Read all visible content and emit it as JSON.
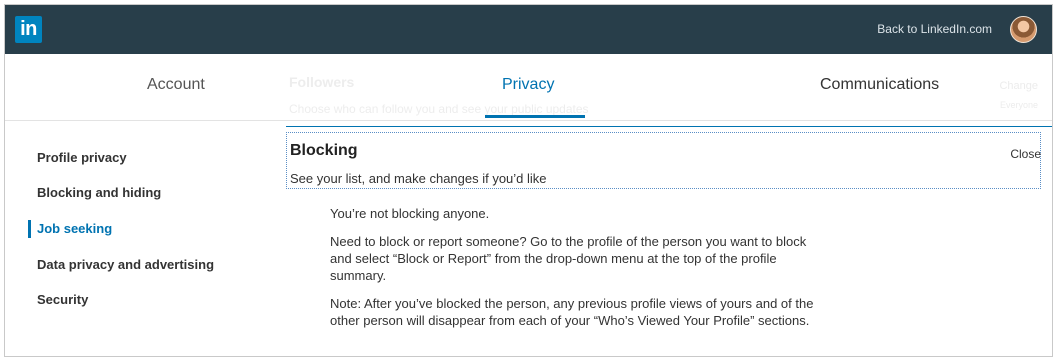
{
  "header": {
    "logo_text": "in",
    "back_link": "Back to LinkedIn.com"
  },
  "tabs": {
    "account": "Account",
    "privacy": "Privacy",
    "communications": "Communications"
  },
  "background_section": {
    "title": "Followers",
    "subtitle": "Choose who can follow you and see your public updates",
    "change": "Change",
    "status": "Everyone"
  },
  "sidebar": {
    "items": [
      {
        "label": "Profile privacy"
      },
      {
        "label": "Blocking and hiding"
      },
      {
        "label": "Job seeking"
      },
      {
        "label": "Data privacy and advertising"
      },
      {
        "label": "Security"
      }
    ],
    "active_index": 2
  },
  "blocking": {
    "title": "Blocking",
    "subtitle": "See your list, and make changes if you’d like",
    "close": "Close",
    "paragraphs": [
      "You’re not blocking anyone.",
      "Need to block or report someone? Go to the profile of the person you want to block and select “Block or Report” from the drop-down menu at the top of the profile summary.",
      "Note: After you’ve blocked the person, any previous profile views of yours and of the other person will disappear from each of your “Who’s Viewed Your Profile” sections."
    ]
  },
  "colors": {
    "topbar": "#283e4a",
    "brand": "#0084bf",
    "accent": "#0073b1"
  }
}
